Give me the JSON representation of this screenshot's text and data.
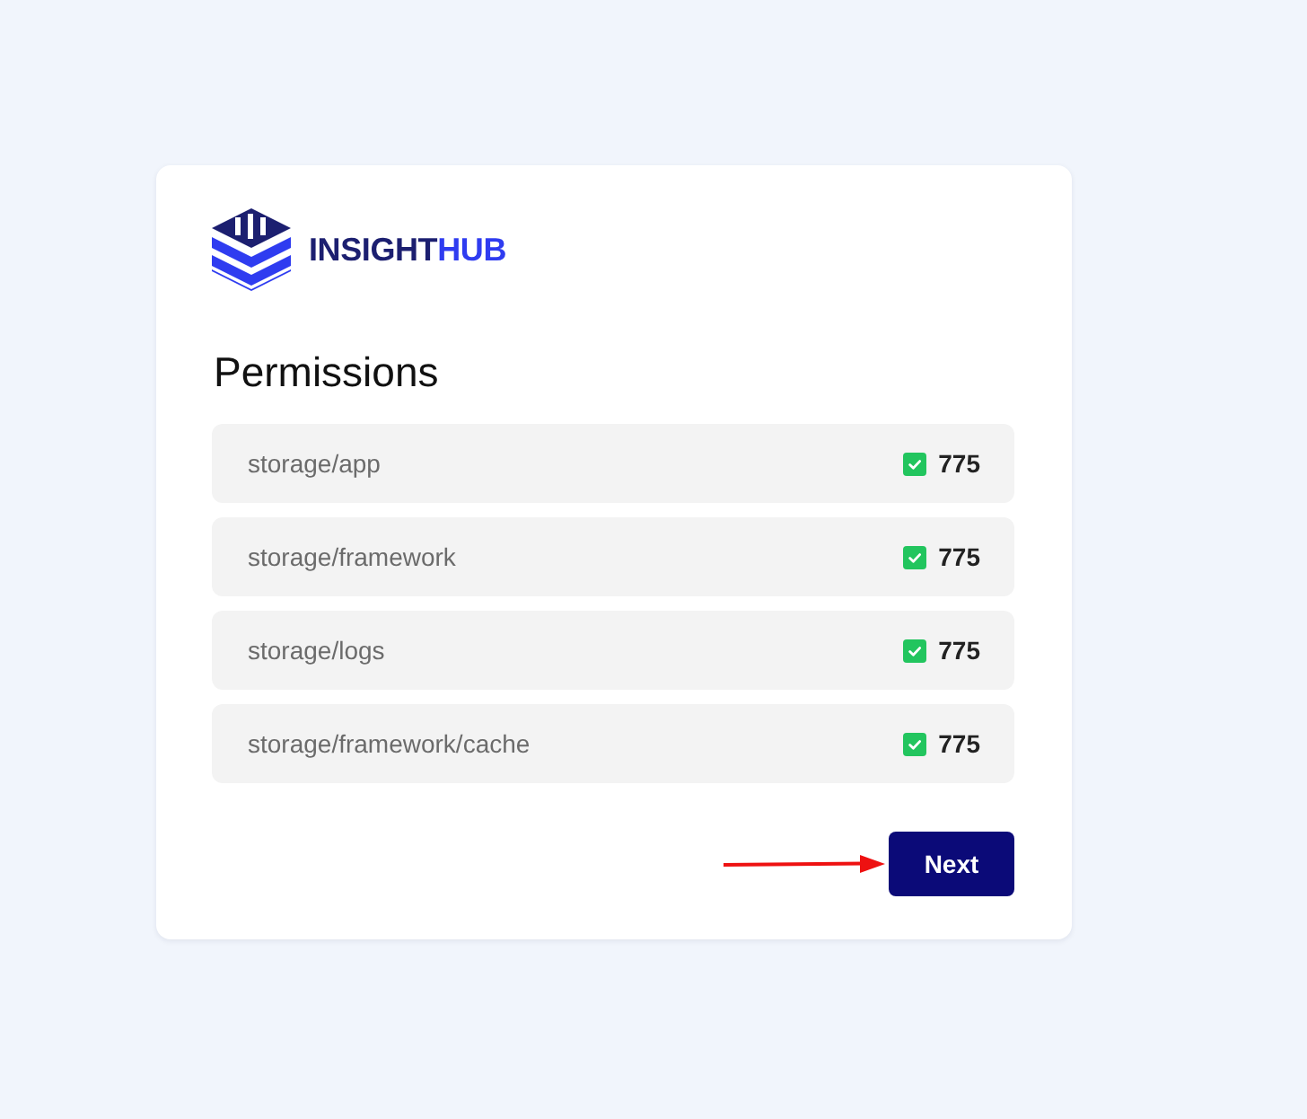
{
  "logo": {
    "name_part_1": "INSIGHT",
    "name_part_2": "HUB"
  },
  "title": "Permissions",
  "permissions": [
    {
      "path": "storage/app",
      "checked": true,
      "value": "775"
    },
    {
      "path": "storage/framework",
      "checked": true,
      "value": "775"
    },
    {
      "path": "storage/logs",
      "checked": true,
      "value": "775"
    },
    {
      "path": "storage/framework/cache",
      "checked": true,
      "value": "775"
    }
  ],
  "next_button": {
    "label": "Next"
  }
}
